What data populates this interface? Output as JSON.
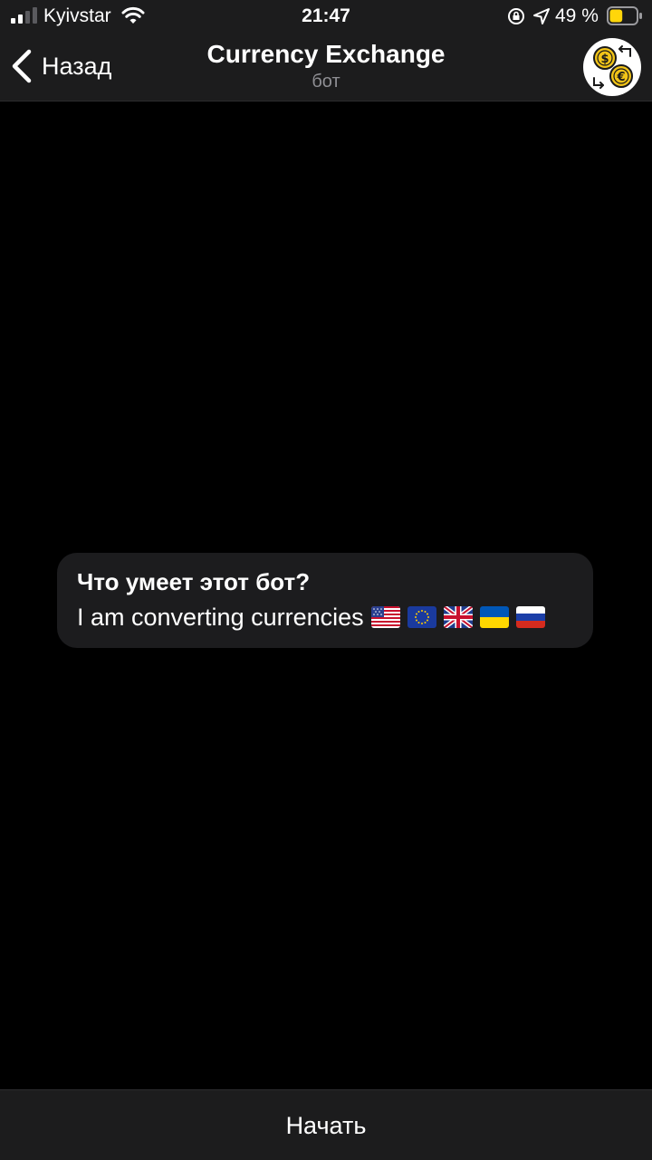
{
  "status_bar": {
    "carrier": "Kyivstar",
    "time": "21:47",
    "battery_percent": "49 %",
    "signal_bars_active": 2,
    "signal_bars_total": 4,
    "battery_level": 0.49,
    "battery_color": "#ffd60a"
  },
  "header": {
    "back_label": "Назад",
    "title": "Currency Exchange",
    "subtitle": "бот",
    "avatar_icon": "currency-exchange-icon"
  },
  "bot_info": {
    "title": "Что умеет этот бот?",
    "text": "I am converting currencies",
    "flags": [
      "flag-us-icon",
      "flag-eu-icon",
      "flag-gb-icon",
      "flag-ua-icon",
      "flag-ru-icon"
    ]
  },
  "bottom": {
    "start_label": "Начать"
  },
  "colors": {
    "background": "#000000",
    "bar": "#1c1c1d",
    "card": "#1c1c1e",
    "secondary_text": "#8e8e93"
  }
}
